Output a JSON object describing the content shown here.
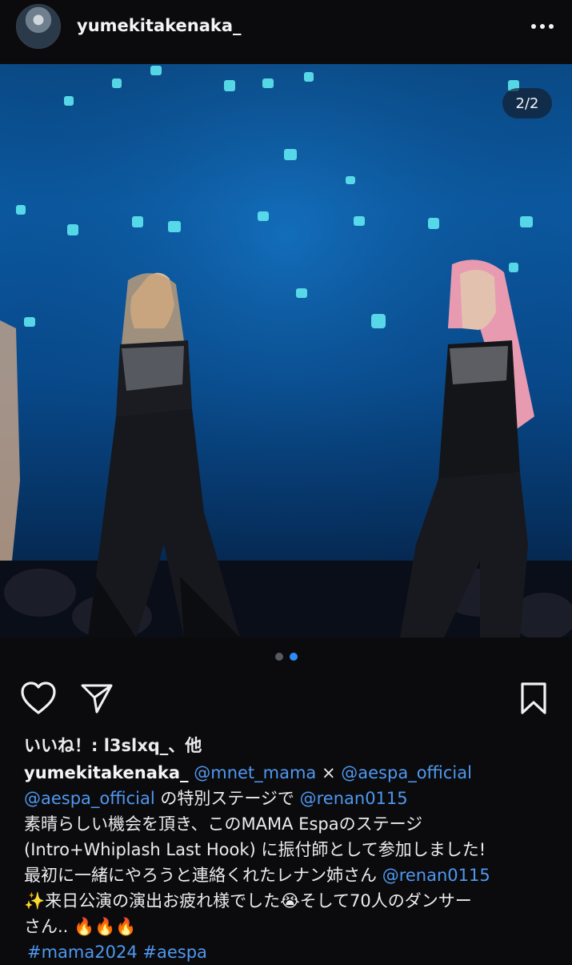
{
  "header": {
    "username": "yumekitakenaka_",
    "more_icon": "more-horizontal-icon"
  },
  "media": {
    "counter": "2/2",
    "page_index": 2,
    "page_count": 2
  },
  "actions": {
    "like_icon": "heart-icon",
    "share_icon": "send-icon",
    "save_icon": "bookmark-icon"
  },
  "likes": {
    "text": "いいね！: l3slxq_、他"
  },
  "caption": {
    "username": "yumekitakenaka_",
    "m1": "@mnet_mama",
    "sep1": " × ",
    "m2": "@aespa_official",
    "m3": "@aespa_official",
    "t1": " の特別ステージで ",
    "m4": "@renan0115",
    "line3": "素晴らしい機会を頂き、このMAMA Espaのステージ",
    "line4": "(Intro+Whiplash Last Hook) に振付師として参加しました!",
    "line5": "最初に一緒にやろうと連絡くれたレナン姉さん ",
    "m5": "@renan0115",
    "line6": "✨来日公演の演出お疲れ様でした😭そして70人のダンサー",
    "line7": "さん.. 🔥🔥🔥",
    "tag1": "#mama2024",
    "tag2": "#aespa"
  },
  "colors": {
    "background": "#0b0b0d",
    "link": "#4f98f0",
    "dot_active": "#2f8cf6"
  }
}
